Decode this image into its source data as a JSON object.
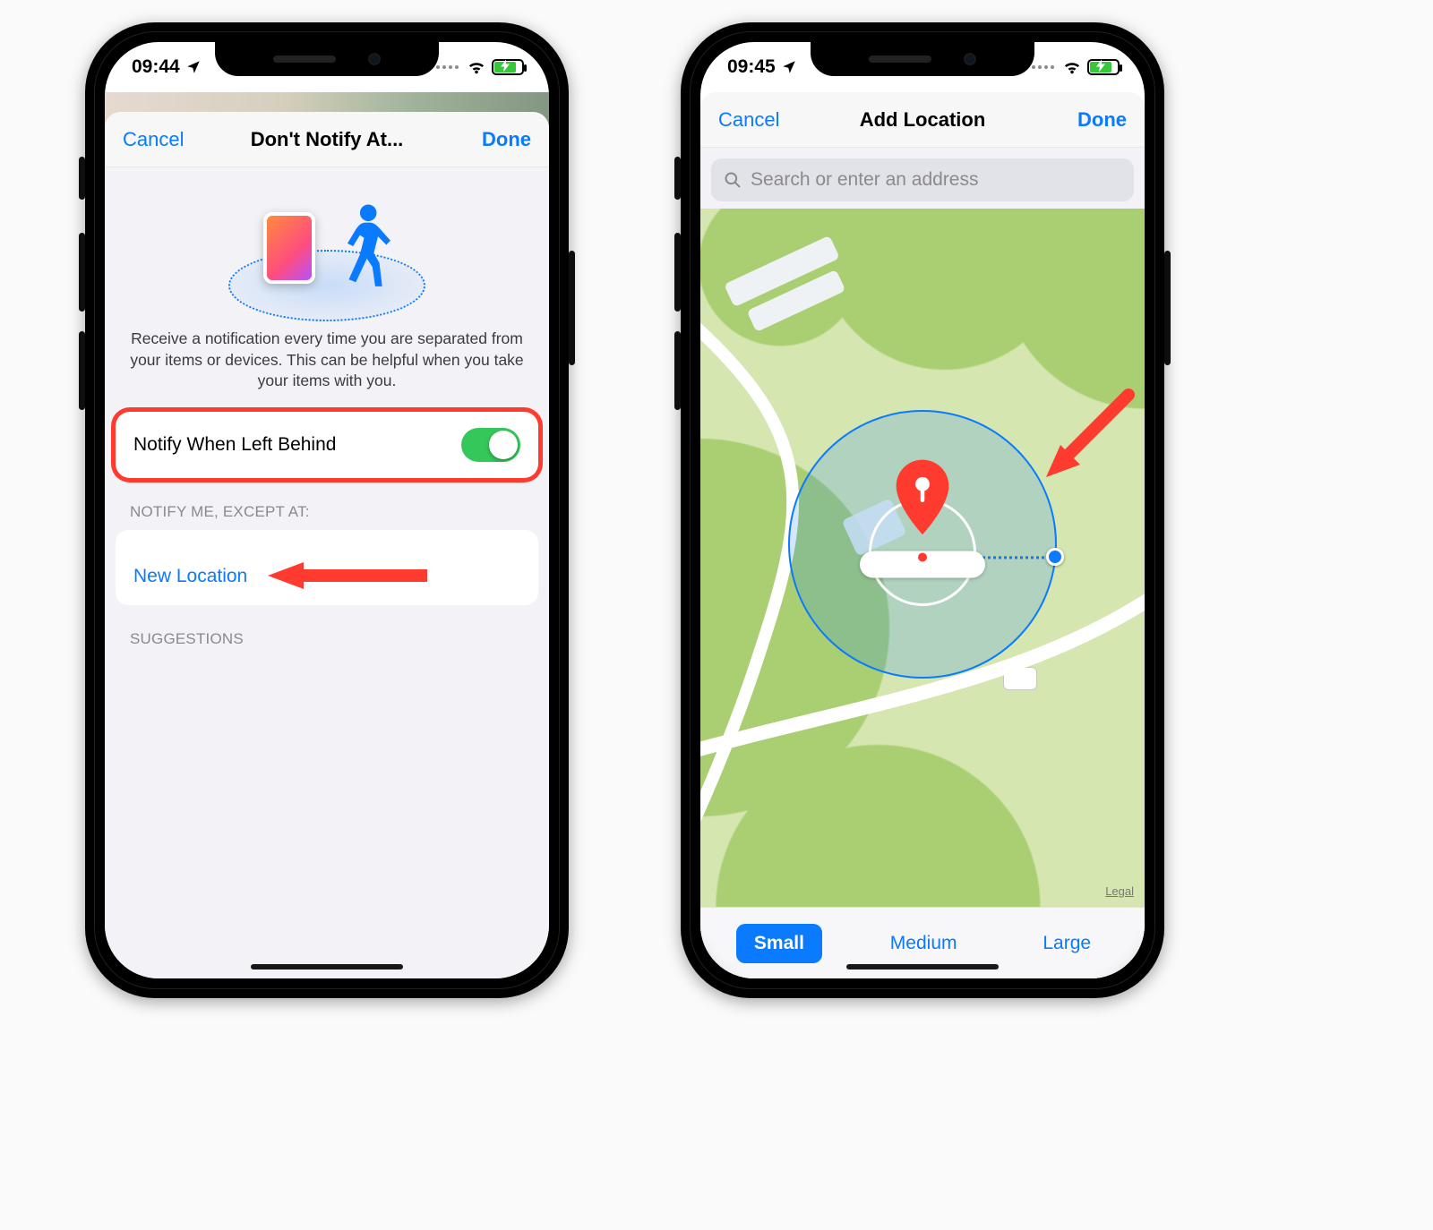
{
  "left": {
    "status": {
      "time": "09:44"
    },
    "header": {
      "cancel": "Cancel",
      "title": "Don't Notify At...",
      "done": "Done"
    },
    "description": "Receive a notification every time you are separated from your items or devices. This can be helpful when you take your items with you.",
    "toggle": {
      "label": "Notify When Left Behind",
      "on": true
    },
    "sections": {
      "except_label": "NOTIFY ME, EXCEPT AT:",
      "new_location": "New Location",
      "suggestions_label": "SUGGESTIONS"
    }
  },
  "right": {
    "status": {
      "time": "09:45"
    },
    "header": {
      "cancel": "Cancel",
      "title": "Add Location",
      "done": "Done"
    },
    "search": {
      "placeholder": "Search or enter an address"
    },
    "map": {
      "legal": "Legal"
    },
    "sizes": {
      "small": "Small",
      "medium": "Medium",
      "large": "Large",
      "selected": "small"
    }
  }
}
